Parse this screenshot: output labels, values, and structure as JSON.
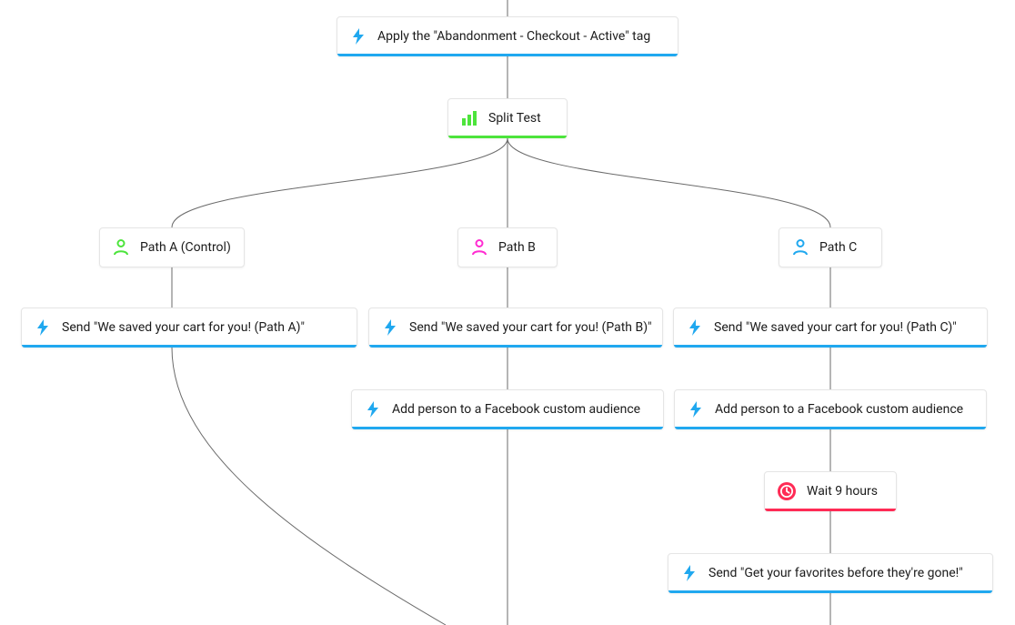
{
  "colors": {
    "action_accent": "#20a8ef",
    "split_accent": "#4de43c",
    "wait_accent": "#ff2b55",
    "path_a_icon": "#4de43c",
    "path_b_icon": "#ff2bd1",
    "path_c_icon": "#20a8ef"
  },
  "nodes": {
    "apply_tag": {
      "label": "Apply the \"Abandonment - Checkout - Active\" tag",
      "type": "action"
    },
    "split_test": {
      "label": "Split Test",
      "type": "split"
    },
    "path_a": {
      "label": "Path A (Control)",
      "type": "path"
    },
    "path_b": {
      "label": "Path B",
      "type": "path"
    },
    "path_c": {
      "label": "Path C",
      "type": "path"
    },
    "send_a": {
      "label": "Send \"We saved your cart for you! (Path A)\"",
      "type": "action"
    },
    "send_b": {
      "label": "Send \"We saved your cart for you! (Path B)\"",
      "type": "action"
    },
    "send_c": {
      "label": "Send \"We saved your cart for you! (Path C)\"",
      "type": "action"
    },
    "fb_b": {
      "label": "Add person to a Facebook custom audience",
      "type": "action"
    },
    "fb_c": {
      "label": "Add person to a Facebook custom audience",
      "type": "action"
    },
    "wait_c": {
      "label": "Wait 9 hours",
      "type": "wait"
    },
    "send_c2": {
      "label": "Send \"Get your favorites before they're gone!\"",
      "type": "action"
    }
  }
}
